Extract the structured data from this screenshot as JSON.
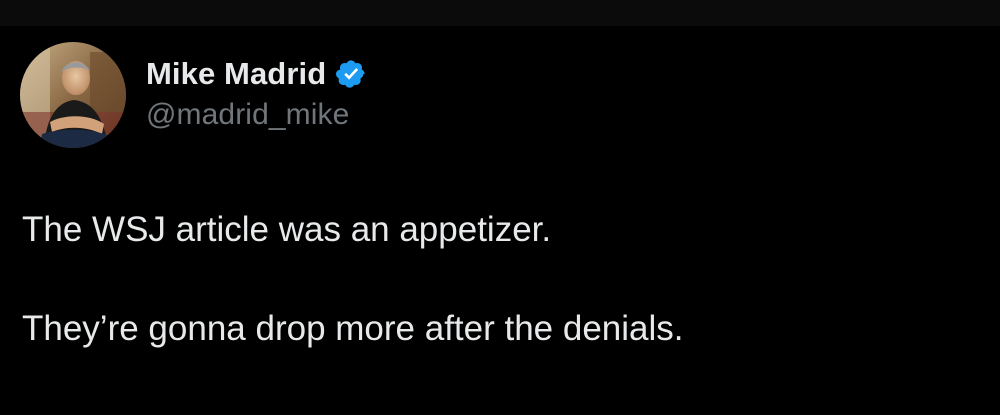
{
  "tweet": {
    "author": {
      "name": "Mike Madrid",
      "handle": "@madrid_mike",
      "verified": true,
      "avatar_icon": "profile-photo-icon",
      "verified_icon": "verified-badge-icon"
    },
    "lines": [
      "The WSJ article was an appetizer.",
      "They’re gonna drop more after the denials."
    ]
  },
  "colors": {
    "background": "#000000",
    "top_strip": "#0b0b0b",
    "text_primary": "#e7e9ea",
    "text_secondary": "#71767b",
    "verified_blue": "#1d9bf0"
  }
}
